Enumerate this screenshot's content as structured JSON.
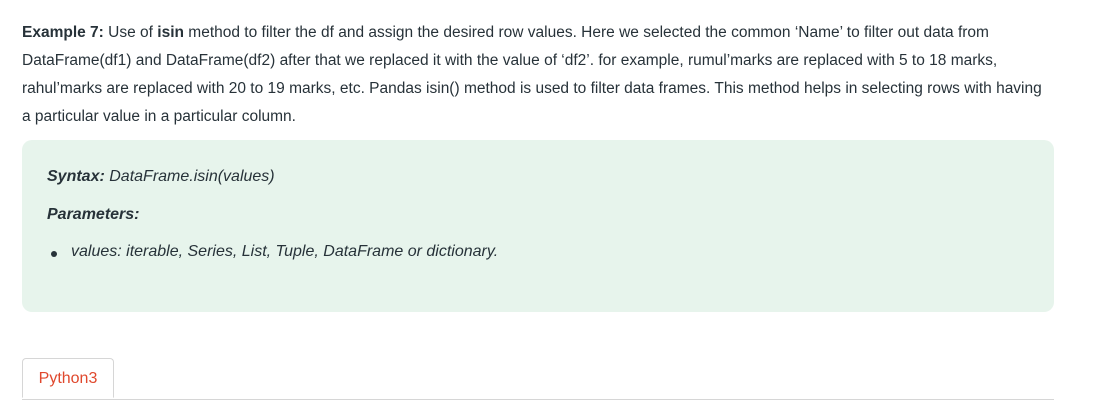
{
  "intro": {
    "label": "Example 7:",
    "text_1": " Use of ",
    "method": "isin",
    "text_2": " method to filter the df and assign the desired row values. Here we selected the common ‘Name’ to filter out data from DataFrame(df1) and DataFrame(df2) after that we replaced it with the value of ‘df2’. for example, rumul’marks are replaced with 5 to 18 marks, rahul’marks are replaced with 20 to 19 marks, etc. Pandas isin() method is used to filter data frames. This method helps in selecting rows with having a particular value in a particular column."
  },
  "syntax": {
    "label": "Syntax:",
    "value": " DataFrame.isin(values)"
  },
  "parameters": {
    "label": "Parameters:",
    "items": [
      "values: iterable, Series, List, Tuple, DataFrame or dictionary."
    ]
  },
  "tabs": {
    "active": "Python3"
  },
  "colors": {
    "box_background": "#e7f4ec",
    "tab_accent": "#e0482d",
    "text": "#273239"
  }
}
